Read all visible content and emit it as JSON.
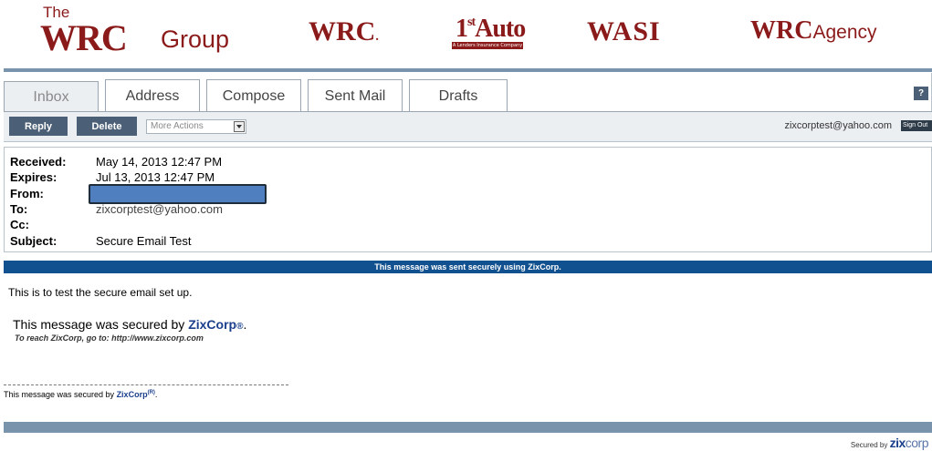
{
  "banner": {
    "wrcgroup_the": "The",
    "wrcgroup_wrc": "WRC",
    "wrcgroup_group": "Group",
    "wrc": "WRC",
    "wrc_mark": ".",
    "firstauto_num": "1",
    "firstauto_sup": "st",
    "firstauto_word": "Auto",
    "firstauto_tag": "A Lenders Insurance Company",
    "wasi": "WASI",
    "wrcagency_wrc": "WRC",
    "wrcagency_agency": "Agency"
  },
  "tabs": {
    "inbox": "Inbox",
    "address": "Address",
    "compose": "Compose",
    "sent": "Sent Mail",
    "drafts": "Drafts",
    "help": "?"
  },
  "toolbar": {
    "reply": "Reply",
    "delete": "Delete",
    "more_actions": "More Actions",
    "user_email": "zixcorptest@yahoo.com",
    "sign_out": "Sign Out"
  },
  "headers": {
    "received_label": "Received:",
    "received_value": "May 14, 2013 12:47 PM",
    "expires_label": "Expires:",
    "expires_value": "Jul 13, 2013 12:47 PM",
    "from_label": "From:",
    "to_label": "To:",
    "to_value": "zixcorptest@yahoo.com",
    "cc_label": "Cc:",
    "subject_label": "Subject:",
    "subject_value": "Secure Email Test"
  },
  "secure_bar": "This message was sent securely using ZixCorp.",
  "message": {
    "body": "This is to test the secure email set up.",
    "secured_prefix": "This message was secured by ",
    "brand": "ZixCorp",
    "reg": "®",
    "period": ".",
    "reach": "To reach ZixCorp, go to: http://www.zixcorp.com",
    "footer_prefix": "This message was secured by ",
    "footer_brand": "ZixCorp",
    "footer_reg": "(R)",
    "footer_period": "."
  },
  "footer": {
    "secured_by": "Secured by",
    "zix": "zix",
    "corp": "corp"
  },
  "colors": {
    "brand_red": "#8b1a1a",
    "toolbar_button": "#4b6076",
    "secure_bar": "#11518f",
    "rule": "#7a93ad",
    "redaction": "#4f7fbf"
  }
}
